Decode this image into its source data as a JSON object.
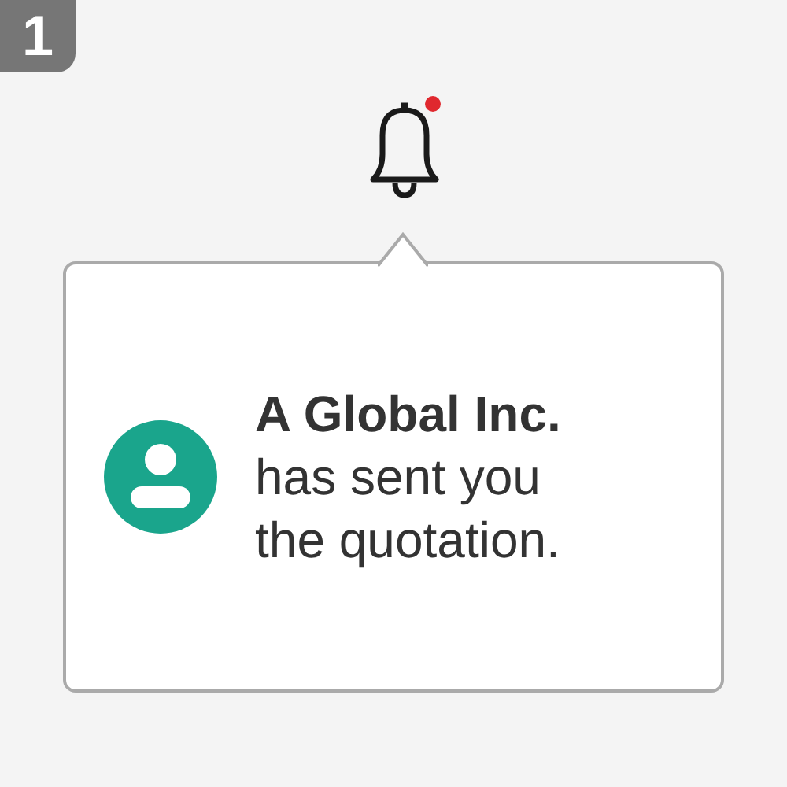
{
  "step_badge": "1",
  "notification": {
    "unread": true,
    "sender": "A Global Inc.",
    "message": "has sent you the quotation."
  }
}
